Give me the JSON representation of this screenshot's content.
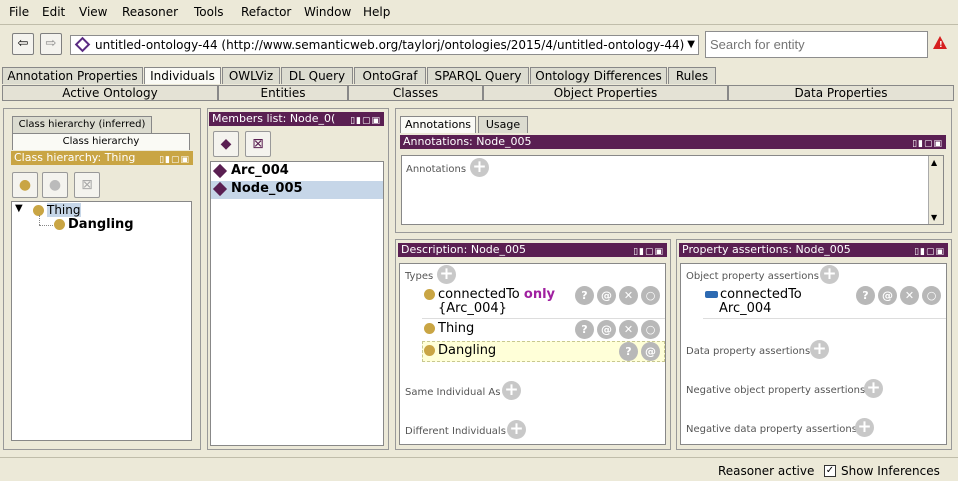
{
  "menu": [
    "File",
    "Edit",
    "View",
    "Reasoner",
    "Tools",
    "Refactor",
    "Window",
    "Help"
  ],
  "address": {
    "ontology": "untitled-ontology-44 (http://www.semanticweb.org/taylorj/ontologies/2015/4/untitled-ontology-44)",
    "search_placeholder": "Search for entity"
  },
  "tabs_row1": [
    "Annotation Properties",
    "Individuals",
    "OWLViz",
    "DL Query",
    "OntoGraf",
    "SPARQL Query",
    "Ontology Differences",
    "Rules"
  ],
  "tabs_row2": [
    "Active Ontology",
    "Entities",
    "Classes",
    "Object Properties",
    "Data Properties"
  ],
  "class_panel": {
    "tab_inferred": "Class hierarchy (inferred)",
    "tab_asserted": "Class hierarchy",
    "title": "Class hierarchy: Thing",
    "tree": [
      "Thing",
      "Dangling"
    ]
  },
  "members": {
    "title": "Members list: Node_0(",
    "items": [
      "Arc_004",
      "Node_005"
    ]
  },
  "annotations": {
    "tab_annotations": "Annotations",
    "tab_usage": "Usage",
    "title": "Annotations: Node_005",
    "label": "Annotations"
  },
  "description": {
    "title": "Description: Node_005",
    "types_label": "Types",
    "type1_prop": "connectedTo",
    "type1_kw": "only",
    "type1_val": "{Arc_004}",
    "type2": "Thing",
    "type3": "Dangling",
    "same_label": "Same Individual As",
    "diff_label": "Different Individuals"
  },
  "property": {
    "title": "Property assertions: Node_005",
    "obj_label": "Object property assertions",
    "obj_prop": "connectedTo",
    "obj_val": "Arc_004",
    "data_label": "Data property assertions",
    "neg_obj_label": "Negative object property assertions",
    "neg_data_label": "Negative data property assertions"
  },
  "status": {
    "reasoner": "Reasoner active",
    "show_inferences": "Show Inferences"
  },
  "colors": {
    "purple": "#5a1f52",
    "gold": "#c9a544",
    "selected": "#c6d6e8"
  }
}
